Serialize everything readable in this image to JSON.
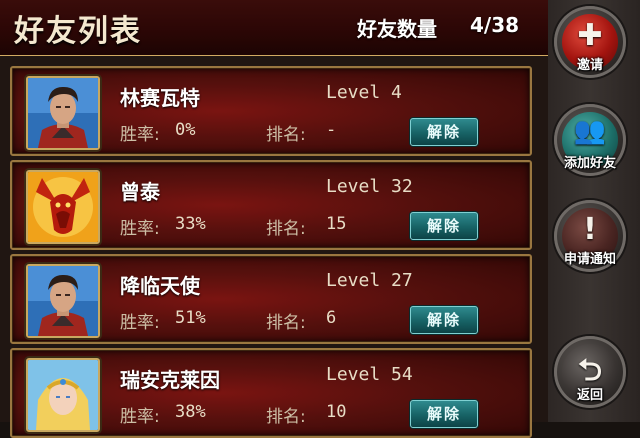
{
  "header": {
    "title": "好友列表",
    "count_label": "好友数量",
    "count_value": "4/38"
  },
  "friends": [
    {
      "name": "林赛瓦特",
      "level": "Level 4",
      "win_label": "胜率:",
      "win_rate": "0%",
      "rank_label": "排名:",
      "rank": "-",
      "remove_label": "解除",
      "avatar": "warrior-avatar"
    },
    {
      "name": "曾泰",
      "level": "Level 32",
      "win_label": "胜率:",
      "win_rate": "33%",
      "rank_label": "排名:",
      "rank": "15",
      "remove_label": "解除",
      "avatar": "dragon-avatar"
    },
    {
      "name": "降临天使",
      "level": "Level 27",
      "win_label": "胜率:",
      "win_rate": "51%",
      "rank_label": "排名:",
      "rank": "6",
      "remove_label": "解除",
      "avatar": "warrior-avatar"
    },
    {
      "name": "瑞安克莱因",
      "level": "Level 54",
      "win_label": "胜率:",
      "win_rate": "38%",
      "rank_label": "排名:",
      "rank": "10",
      "remove_label": "解除",
      "avatar": "priestess-avatar"
    }
  ],
  "side_buttons": [
    {
      "label": "邀请",
      "icon": "plus-icon",
      "color": "#a3140f"
    },
    {
      "label": "添加好友",
      "icon": "add-friend-icon",
      "color": "#1d6f69"
    },
    {
      "label": "申请通知",
      "icon": "exclamation-icon",
      "color": "#4a2522"
    },
    {
      "label": "返回",
      "icon": "return-arrow-icon",
      "color": "#2b2725"
    }
  ]
}
